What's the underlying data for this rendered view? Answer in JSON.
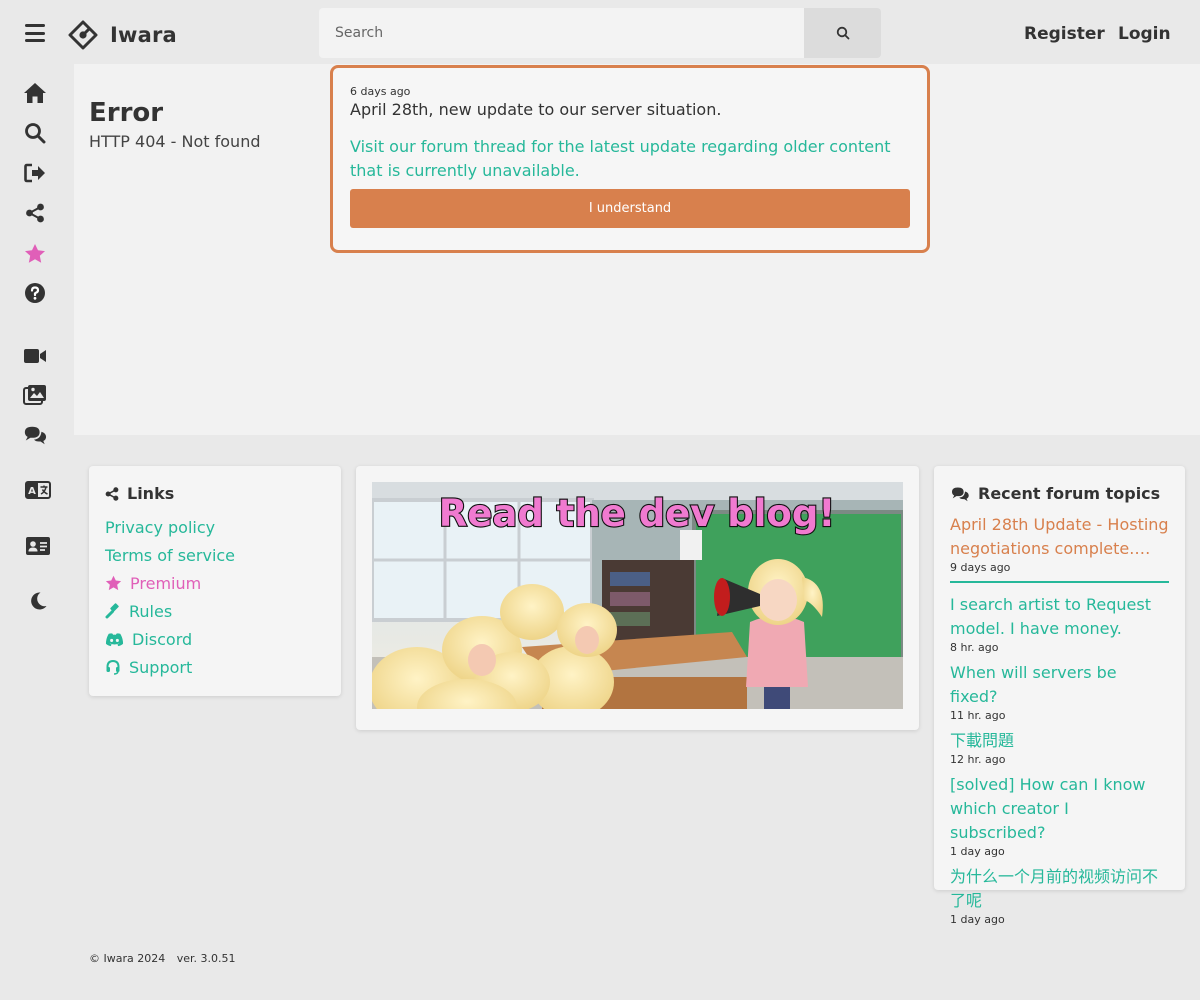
{
  "header": {
    "brand": "Iwara",
    "search_placeholder": "Search",
    "register_label": "Register",
    "login_label": "Login"
  },
  "sidebar": {
    "icons": [
      "home-icon",
      "search-icon",
      "logout-icon",
      "share-icon",
      "star-icon",
      "help-icon",
      "video-icon",
      "images-icon",
      "forum-icon",
      "language-icon",
      "contact-card-icon",
      "dark-mode-icon"
    ]
  },
  "error": {
    "title": "Error",
    "message": "HTTP 404 - Not found"
  },
  "notice": {
    "time": "6 days ago",
    "headline": "April 28th, new update to our server situation.",
    "link_text": "Visit our forum thread for the latest update regarding older content that is currently unavailable.",
    "button_label": "I understand",
    "accent_color": "#d8804d"
  },
  "links": {
    "title": "Links",
    "items": [
      {
        "label": "Privacy policy"
      },
      {
        "label": "Terms of service"
      },
      {
        "label": "Premium"
      },
      {
        "label": "Rules"
      },
      {
        "label": "Discord"
      },
      {
        "label": "Support"
      }
    ]
  },
  "blog": {
    "banner_text": "Read the dev blog!"
  },
  "forum": {
    "title": "Recent forum topics",
    "topics": [
      {
        "title": "April 28th Update - Hosting negotiations complete. Ne...",
        "time": "9 days ago"
      },
      {
        "title": "I search artist to Request model. I have money.",
        "time": "8 hr. ago"
      },
      {
        "title": "When will servers be fixed?",
        "time": "11 hr. ago"
      },
      {
        "title": "下載問題",
        "time": "12 hr. ago"
      },
      {
        "title": "[solved] How can I know which creator I subscribed?",
        "time": "1 day ago"
      },
      {
        "title": "为什么一个月前的视频访问不了呢",
        "time": "1 day ago"
      }
    ]
  },
  "footer": {
    "copyright": "© Iwara 2024",
    "version": "ver. 3.0.51"
  },
  "colors": {
    "link": "#26b89a",
    "premium": "#e05fb8",
    "accent": "#d8804d"
  }
}
